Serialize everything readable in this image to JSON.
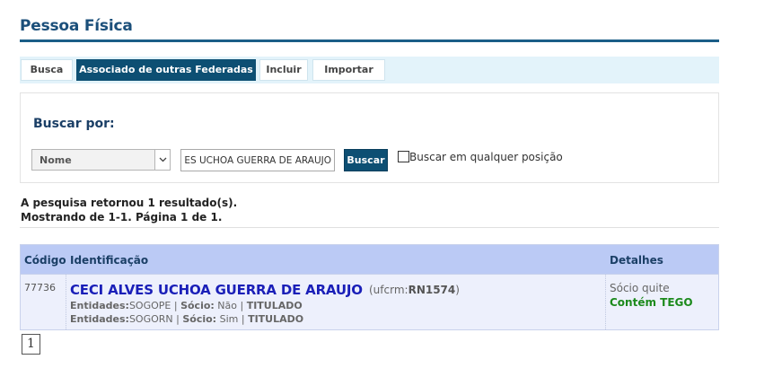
{
  "page": {
    "title": "Pessoa Física"
  },
  "tabs": [
    {
      "label": "Busca"
    },
    {
      "label": "Associado de outras Federadas",
      "active": true
    },
    {
      "label": "Incluir"
    },
    {
      "label": "Importar"
    }
  ],
  "search": {
    "label": "Buscar por:",
    "field_select": "Nome",
    "query_value": "CECI ALVES UCHOA GUERRA DE ARAUJO",
    "button_label": "Buscar",
    "anywhere_label": "Buscar em qualquer posição",
    "anywhere_checked": false
  },
  "results": {
    "summary_line1": "A pesquisa retornou 1 resultado(s).",
    "summary_line2": "Mostrando de 1-1. Página 1 de 1.",
    "headers": {
      "code": "Código",
      "ident": "Identificação",
      "details": "Detalhes"
    },
    "rows": [
      {
        "code": "77736",
        "name": "CECI ALVES UCHOA GUERRA DE ARAUJO",
        "meta_prefix": "(ufcrm:",
        "meta_value": "RN1574",
        "meta_suffix": ")",
        "entities": [
          {
            "label": "Entidades:",
            "entity": "SOGOPE",
            "socio_label": "Sócio:",
            "socio_value": "Não",
            "status": "TITULADO"
          },
          {
            "label": "Entidades:",
            "entity": "SOGORN",
            "socio_label": "Sócio:",
            "socio_value": "Sim",
            "status": "TITULADO"
          }
        ],
        "detail_status": "Sócio quite",
        "detail_tego": "Contém TEGO"
      }
    ]
  },
  "pagination": {
    "current": "1"
  },
  "colors": {
    "brand": "#0d4f73",
    "header_bg": "#bbcaf5",
    "row_bg": "#edf0fc",
    "name_link": "#1a1fb8",
    "tego_green": "#1c8a1c"
  }
}
